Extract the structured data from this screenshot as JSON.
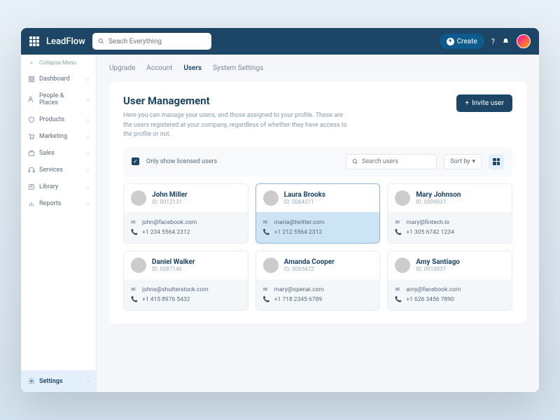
{
  "header": {
    "brand": "LeadFlow",
    "search_placeholder": "Seach Everything",
    "create_label": "Create"
  },
  "sidebar": {
    "collapse": "Collapse Menu",
    "items": [
      {
        "label": "Dashboard"
      },
      {
        "label": "People & Places"
      },
      {
        "label": "Products"
      },
      {
        "label": "Marketing"
      },
      {
        "label": "Sales"
      },
      {
        "label": "Services"
      },
      {
        "label": "Library"
      },
      {
        "label": "Reports"
      }
    ],
    "settings": "Settings"
  },
  "tabs": [
    {
      "label": "Upgrade"
    },
    {
      "label": "Account"
    },
    {
      "label": "Users"
    },
    {
      "label": "System Settings"
    }
  ],
  "panel": {
    "title": "User Management",
    "subtitle": "Here you can manage your users, and those assigned to your profile. These are the users registered at your company, regardless of whether they have access to the profile or not.",
    "invite_label": "Invite user"
  },
  "filters": {
    "licensed_label": "Only show licensed users",
    "search_placeholder": "Search users",
    "sort_label": "Sort by"
  },
  "users": [
    {
      "name": "John Miller",
      "id": "ID: 0012131",
      "email": "john@facebook.com",
      "phone": "+1 234 5564 2312"
    },
    {
      "name": "Laura Brooks",
      "id": "ID: 0064211",
      "email": "maria@twitter.com",
      "phone": "+1 212 5564 2312"
    },
    {
      "name": "Mary Johnson",
      "id": "ID: 0009837",
      "email": "mary@fintech.io",
      "phone": "+1 305 6742 1234"
    },
    {
      "name": "Daniel Walker",
      "id": "ID: 0087146",
      "email": "johns@shutterstock.com",
      "phone": "+1 415 8976 5432"
    },
    {
      "name": "Amanda Cooper",
      "id": "ID: 0065472",
      "email": "mary@openai.com",
      "phone": "+1 718 2345 6789"
    },
    {
      "name": "Amy Santiago",
      "id": "ID: 0010837",
      "email": "amy@facebook.com",
      "phone": "+1 626 3456 7890"
    }
  ]
}
